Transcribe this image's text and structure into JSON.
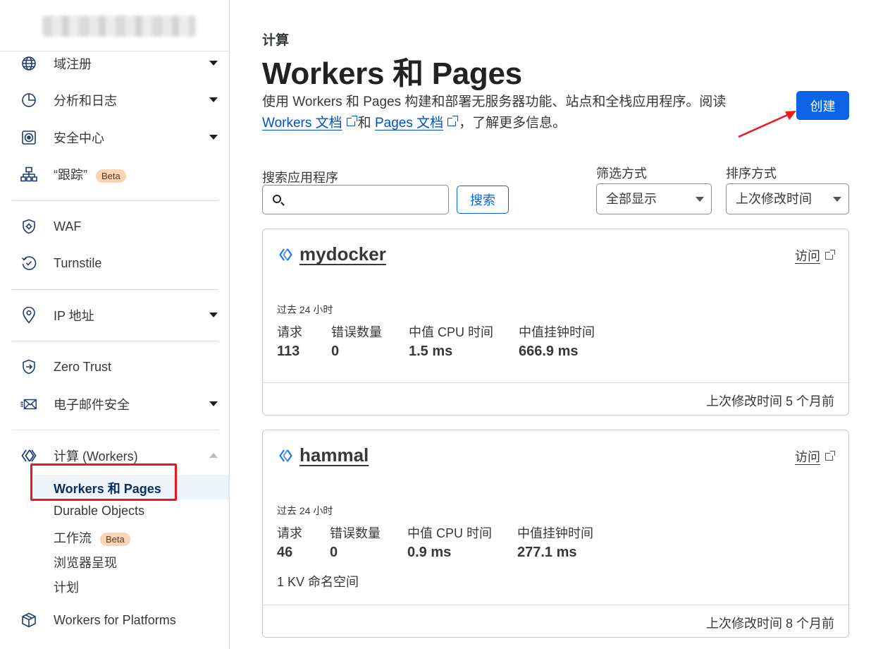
{
  "sidebar": {
    "items": [
      {
        "label": "域注册",
        "icon": "globe-icon"
      },
      {
        "label": "分析和日志",
        "icon": "pie-chart-icon"
      },
      {
        "label": "安全中心",
        "icon": "shield-target-icon"
      },
      {
        "label": "“跟踪”",
        "icon": "sitemap-icon",
        "badge": "Beta"
      },
      {
        "label": "WAF",
        "icon": "shield-gear-icon"
      },
      {
        "label": "Turnstile",
        "icon": "turnstile-icon"
      },
      {
        "label": "IP 地址",
        "icon": "location-pin-icon"
      },
      {
        "label": "Zero Trust",
        "icon": "zero-trust-icon"
      },
      {
        "label": "电子邮件安全",
        "icon": "email-icon"
      },
      {
        "label": "计算 (Workers)",
        "icon": "workers-icon"
      },
      {
        "label": "Workers for Platforms",
        "icon": "box-icon"
      }
    ],
    "sub_items": [
      {
        "label": "Workers 和 Pages"
      },
      {
        "label": "Durable Objects"
      },
      {
        "label": "工作流",
        "badge": "Beta"
      },
      {
        "label": "浏览器呈现"
      },
      {
        "label": "计划"
      }
    ]
  },
  "header": {
    "eyebrow": "计算",
    "title": "Workers 和 Pages",
    "desc_part1": "使用 Workers 和 Pages 构建和部署无服务器功能、站点和全栈应用程序。阅读",
    "workers_docs_link": "Workers 文档",
    "and_text": "和",
    "pages_docs_link": "Pages 文档",
    "desc_part2": "，了解更多信息。",
    "create_label": "创建"
  },
  "search": {
    "label": "搜索应用程序",
    "value": "",
    "button_label": "搜索"
  },
  "filter": {
    "label": "筛选方式",
    "selected": "全部显示"
  },
  "sort": {
    "label": "排序方式",
    "selected": "上次修改时间"
  },
  "apps": [
    {
      "name": "mydocker",
      "visit_label": "访问",
      "period": "过去 24 小时",
      "metrics": [
        {
          "label": "请求",
          "value": "113"
        },
        {
          "label": "错误数量",
          "value": "0"
        },
        {
          "label": "中值 CPU 时间",
          "value": "1.5 ms"
        },
        {
          "label": "中值挂钟时间",
          "value": "666.9 ms"
        }
      ],
      "footer": "上次修改时间 5 个月前"
    },
    {
      "name": "hammal",
      "visit_label": "访问",
      "period": "过去 24 小时",
      "metrics": [
        {
          "label": "请求",
          "value": "46"
        },
        {
          "label": "错误数量",
          "value": "0"
        },
        {
          "label": "中值 CPU 时间",
          "value": "0.9 ms"
        },
        {
          "label": "中值挂钟时间",
          "value": "277.1 ms"
        }
      ],
      "extra": "1 KV 命名空间",
      "footer": "上次修改时间 8 个月前"
    }
  ],
  "colors": {
    "accent": "#0b63e6",
    "link": "#0051c3",
    "annotation": "#e8191a",
    "beta_badge": "#fbd5b3"
  }
}
